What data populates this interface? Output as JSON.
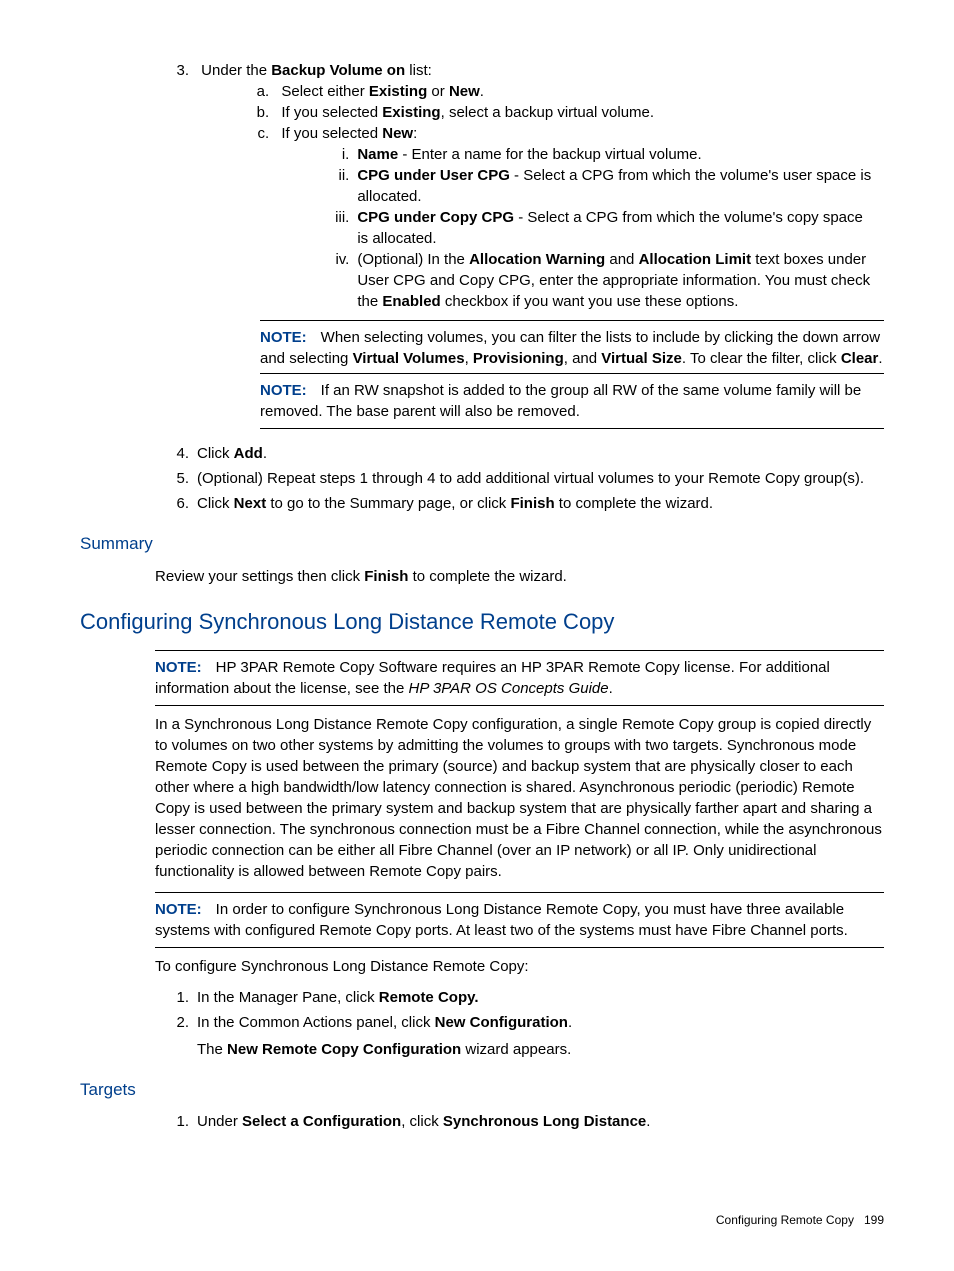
{
  "step3": {
    "num": "3.",
    "text_prefix": "Under the ",
    "text_bold": "Backup Volume on",
    "text_suffix": " list:",
    "a": {
      "num": "a.",
      "pre": "Select either ",
      "b1": "Existing",
      "mid": " or ",
      "b2": "New",
      "suf": "."
    },
    "b": {
      "num": "b.",
      "pre": "If you selected ",
      "b1": "Existing",
      "suf": ", select a backup virtual volume."
    },
    "c": {
      "num": "c.",
      "pre": "If you selected ",
      "b1": "New",
      "suf": ":"
    },
    "c_i": {
      "num": "i.",
      "b1": "Name",
      "suf": " - Enter a name for the backup virtual volume."
    },
    "c_ii": {
      "num": "ii.",
      "b1": "CPG under User CPG",
      "suf": " - Select a CPG from which the volume's user space is allocated."
    },
    "c_iii": {
      "num": "iii.",
      "b1": "CPG under Copy CPG",
      "suf": " - Select a CPG from which the volume's copy space is allocated."
    },
    "c_iv": {
      "num": "iv.",
      "pre": "(Optional) In the ",
      "b1": "Allocation Warning",
      "mid1": " and ",
      "b2": "Allocation Limit",
      "mid2": " text boxes under User CPG and Copy CPG, enter the appropriate information. You must check the ",
      "b3": "Enabled",
      "suf": " checkbox if you want you use these options."
    }
  },
  "note1": {
    "label": "NOTE:",
    "pre": "When selecting volumes, you can filter the lists to include by clicking the down arrow and selecting ",
    "b1": "Virtual Volumes",
    "s1": ", ",
    "b2": "Provisioning",
    "s2": ", and ",
    "b3": "Virtual Size",
    "s3": ". To clear the filter, click ",
    "b4": "Clear",
    "s4": "."
  },
  "note2": {
    "label": "NOTE:",
    "text": "If an RW snapshot is added to the group all RW of the same volume family will be removed. The base parent will also be removed."
  },
  "step4": {
    "num": "4.",
    "pre": "Click ",
    "b1": "Add",
    "suf": "."
  },
  "step5": {
    "num": "5.",
    "text": "(Optional) Repeat steps 1 through 4 to add additional virtual volumes to your Remote Copy group(s)."
  },
  "step6": {
    "num": "6.",
    "pre": "Click ",
    "b1": "Next",
    "mid": " to go to the Summary page, or click ",
    "b2": "Finish",
    "suf": " to complete the wizard."
  },
  "summary": {
    "heading": "Summary",
    "pre": "Review your settings then click ",
    "b1": "Finish",
    "suf": " to complete the wizard."
  },
  "config": {
    "heading": "Configuring Synchronous Long Distance Remote Copy",
    "note_top": {
      "label": "NOTE:",
      "pre": "HP 3PAR Remote Copy Software requires an HP 3PAR Remote Copy license. For additional information about the license, see the ",
      "italic": "HP 3PAR OS Concepts Guide",
      "suf": "."
    },
    "para": "In a Synchronous Long Distance Remote Copy configuration, a single Remote Copy group is copied directly to volumes on two other systems by admitting the volumes to groups with two targets. Synchronous mode Remote Copy is used between the primary (source) and backup system that are physically closer to each other where a high bandwidth/low latency connection is shared. Asynchronous periodic (periodic) Remote Copy is used between the primary system and backup system that are physically farther apart and sharing a lesser connection. The synchronous connection must be a Fibre Channel connection, while the asynchronous periodic connection can be either all Fibre Channel (over an IP network) or all IP. Only unidirectional functionality is allowed between Remote Copy pairs.",
    "note_mid": {
      "label": "NOTE:",
      "text": "In order to configure Synchronous Long Distance Remote Copy, you must have three available systems with configured Remote Copy ports. At least two of the systems must have Fibre Channel ports."
    },
    "intro": "To configure Synchronous Long Distance Remote Copy:",
    "s1": {
      "num": "1.",
      "pre": "In the Manager Pane, click ",
      "b1": "Remote Copy."
    },
    "s2": {
      "num": "2.",
      "pre": "In the Common Actions panel, click ",
      "b1": "New Configuration",
      "suf": "."
    },
    "s2b": {
      "pre": "The ",
      "b1": "New Remote Copy Configuration",
      "suf": " wizard appears."
    }
  },
  "targets": {
    "heading": "Targets",
    "s1": {
      "num": "1.",
      "pre": "Under ",
      "b1": "Select a Configuration",
      "mid": ", click ",
      "b2": "Synchronous Long Distance",
      "suf": "."
    }
  },
  "footer": {
    "text": "Configuring Remote Copy",
    "page": "199"
  }
}
